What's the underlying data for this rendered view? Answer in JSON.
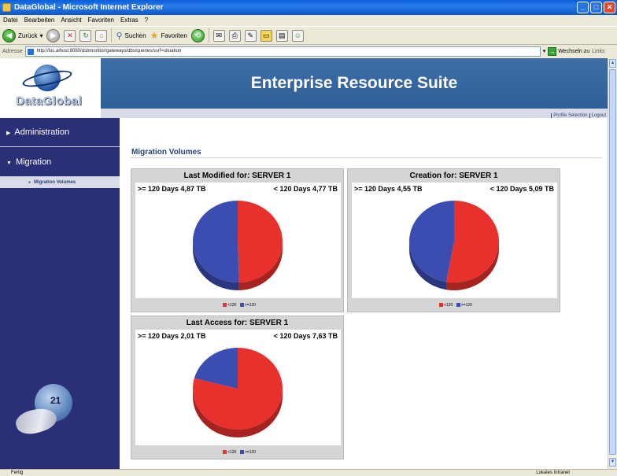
{
  "browser": {
    "title": "DataGlobal - Microsoft Internet Explorer",
    "menu": [
      "Datei",
      "Bearbeiten",
      "Ansicht",
      "Favoriten",
      "Extras",
      "?"
    ],
    "toolbar": {
      "back": "Zurück",
      "search": "Suchen",
      "favorites": "Favoriten"
    },
    "address_label": "Adresse",
    "address_value": "http://loc.alhost:8080/dsbmonitor/gateways/dbs/queries/ssrf=situation",
    "go_label": "Wechseln zu",
    "links_label": "Links",
    "status_left": "Fertig",
    "status_right": "Lokales Intranet"
  },
  "app": {
    "logo_text": "DataGlobal",
    "header_title": "Enterprise Resource Suite",
    "profile_links": [
      "Profile Selection",
      "Logout"
    ],
    "sidebar": {
      "items": [
        {
          "label": "Administration"
        },
        {
          "label": "Migration"
        }
      ],
      "subitem": "Migration Volumes"
    },
    "section_title": "Migration Volumes"
  },
  "chart_data": [
    {
      "type": "pie",
      "title": "Last Modified for: SERVER 1",
      "labels_text": {
        "left": ">= 120 Days 4,87 TB",
        "right": "< 120 Days 4,77 TB"
      },
      "slices": [
        {
          "name": "<120",
          "value": 4.77,
          "color": "#e8302d"
        },
        {
          "name": ">=120",
          "value": 4.87,
          "color": "#3b4db0"
        }
      ],
      "legend": [
        "<120",
        ">=120"
      ]
    },
    {
      "type": "pie",
      "title": "Creation for: SERVER 1",
      "labels_text": {
        "left": ">= 120 Days 4,55 TB",
        "right": "< 120 Days 5,09 TB"
      },
      "slices": [
        {
          "name": "<120",
          "value": 5.09,
          "color": "#e8302d"
        },
        {
          "name": ">=120",
          "value": 4.55,
          "color": "#3b4db0"
        }
      ],
      "legend": [
        "<120",
        ">=120"
      ]
    },
    {
      "type": "pie",
      "title": "Last Access for: SERVER 1",
      "labels_text": {
        "left": ">= 120 Days 2,01 TB",
        "right": "< 120 Days 7,63 TB"
      },
      "slices": [
        {
          "name": "<120",
          "value": 7.63,
          "color": "#e8302d"
        },
        {
          "name": ">=120",
          "value": 2.01,
          "color": "#3b4db0"
        }
      ],
      "legend": [
        "<120",
        ">=120"
      ]
    }
  ]
}
